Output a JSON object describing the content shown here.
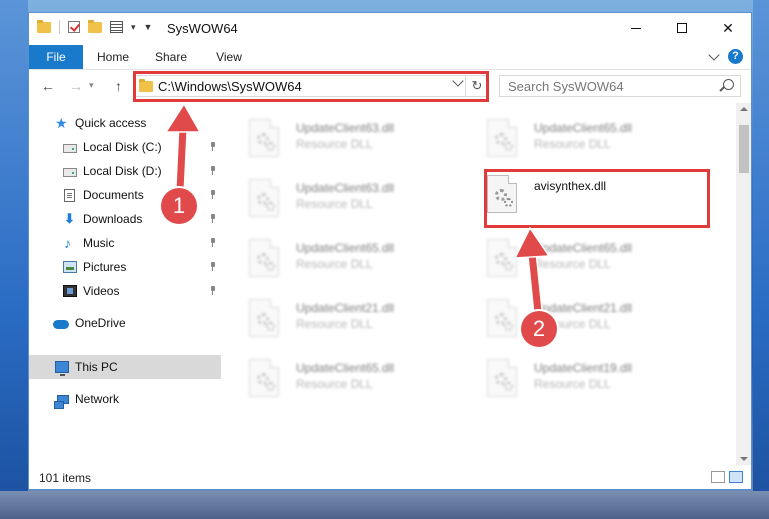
{
  "window": {
    "title": "SysWOW64",
    "minimize_glyph": "",
    "close_glyph": "✕"
  },
  "ribbon": {
    "tabs": [
      "File",
      "Home",
      "Share",
      "View"
    ],
    "help_glyph": "?"
  },
  "address": {
    "path": "C:\\Windows\\SysWOW64",
    "search_placeholder": "Search SysWOW64",
    "refresh_glyph": "↻"
  },
  "nav_glyphs": {
    "back": "←",
    "forward": "→",
    "recent": "▾",
    "up": "↑"
  },
  "sidebar": {
    "items": [
      {
        "label": "Quick access",
        "icon": "star-icon"
      },
      {
        "label": "Local Disk (C:)",
        "icon": "disk-icon",
        "pinned": true
      },
      {
        "label": "Local Disk (D:)",
        "icon": "disk-icon",
        "pinned": true
      },
      {
        "label": "Documents",
        "icon": "documents-icon",
        "pinned": true
      },
      {
        "label": "Downloads",
        "icon": "download-icon",
        "pinned": true
      },
      {
        "label": "Music",
        "icon": "music-icon",
        "pinned": true
      },
      {
        "label": "Pictures",
        "icon": "pictures-icon",
        "pinned": true
      },
      {
        "label": "Videos",
        "icon": "videos-icon",
        "pinned": true
      },
      {
        "label": "OneDrive",
        "icon": "cloud-icon"
      },
      {
        "label": "This PC",
        "icon": "pc-icon",
        "selected": true
      },
      {
        "label": "Network",
        "icon": "network-icon"
      }
    ]
  },
  "files": [
    {
      "name": "UpdateClient63.dll",
      "type": "Resource DLL",
      "blurred": true
    },
    {
      "name": "UpdateClient65.dll",
      "type": "Resource DLL",
      "blurred": true
    },
    {
      "name": "UpdateClient63.dll",
      "type": "Resource DLL",
      "blurred": true
    },
    {
      "name": "avisynthex.dll",
      "type": "",
      "blurred": false
    },
    {
      "name": "UpdateClient65.dll",
      "type": "Resource DLL",
      "blurred": true
    },
    {
      "name": "UpdateClient65.dll",
      "type": "Resource DLL",
      "blurred": true
    },
    {
      "name": "UpdateClient21.dll",
      "type": "Resource DLL",
      "blurred": true
    },
    {
      "name": "UpdateClient21.dll",
      "type": "Resource DLL",
      "blurred": true
    },
    {
      "name": "UpdateClient65.dll",
      "type": "Resource DLL",
      "blurred": true
    },
    {
      "name": "UpdateClient19.dll",
      "type": "Resource DLL",
      "blurred": true
    }
  ],
  "status": {
    "item_count": "101 items"
  },
  "annotations": {
    "step1": "1",
    "step2": "2",
    "color": "#e03a3a"
  }
}
